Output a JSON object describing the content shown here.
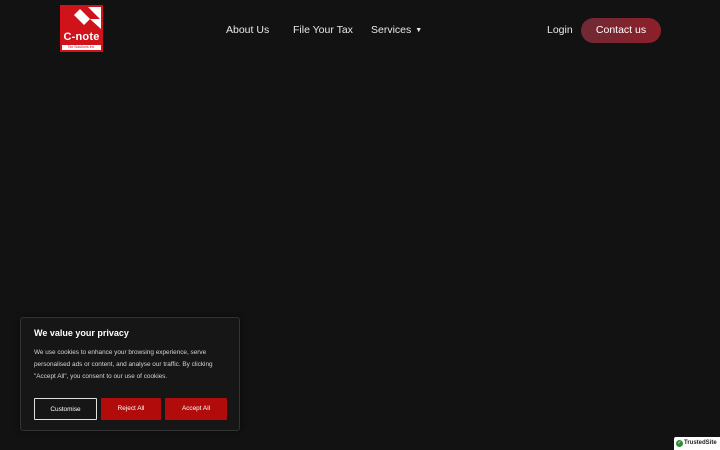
{
  "header": {
    "logo": {
      "name": "C-note",
      "tagline": "Tax Solutions Inc."
    },
    "nav": [
      {
        "label": "About Us"
      },
      {
        "label": "File Your Tax"
      },
      {
        "label": "Services",
        "has_dropdown": true
      }
    ],
    "login_label": "Login",
    "contact_label": "Contact us"
  },
  "cookie_banner": {
    "title": "We value your privacy",
    "body": "We use cookies to enhance your browsing experience, serve personalised ads or content, and analyse our traffic. By clicking \"Accept All\", you consent to our use of cookies.",
    "customise_label": "Customise",
    "reject_label": "Reject All",
    "accept_label": "Accept All"
  },
  "trusted_badge": {
    "label": "TrustedSite"
  },
  "icons": {
    "dropdown": "chevron-down-icon",
    "badge": "check-circle-icon"
  },
  "colors": {
    "background": "#121213",
    "brand_red": "#d0121b",
    "button_red": "#b10b0b",
    "contact_button": "#8e1f2a"
  }
}
